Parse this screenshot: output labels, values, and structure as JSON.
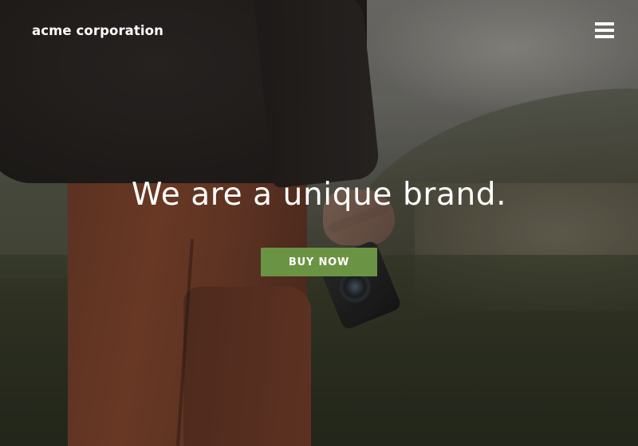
{
  "header": {
    "brand": "acme corporation",
    "menu_icon": "hamburger-menu-icon"
  },
  "hero": {
    "headline": "We are a unique brand.",
    "cta_label": "BUY NOW"
  },
  "colors": {
    "accent": "#6a9443",
    "text": "#ffffff"
  }
}
